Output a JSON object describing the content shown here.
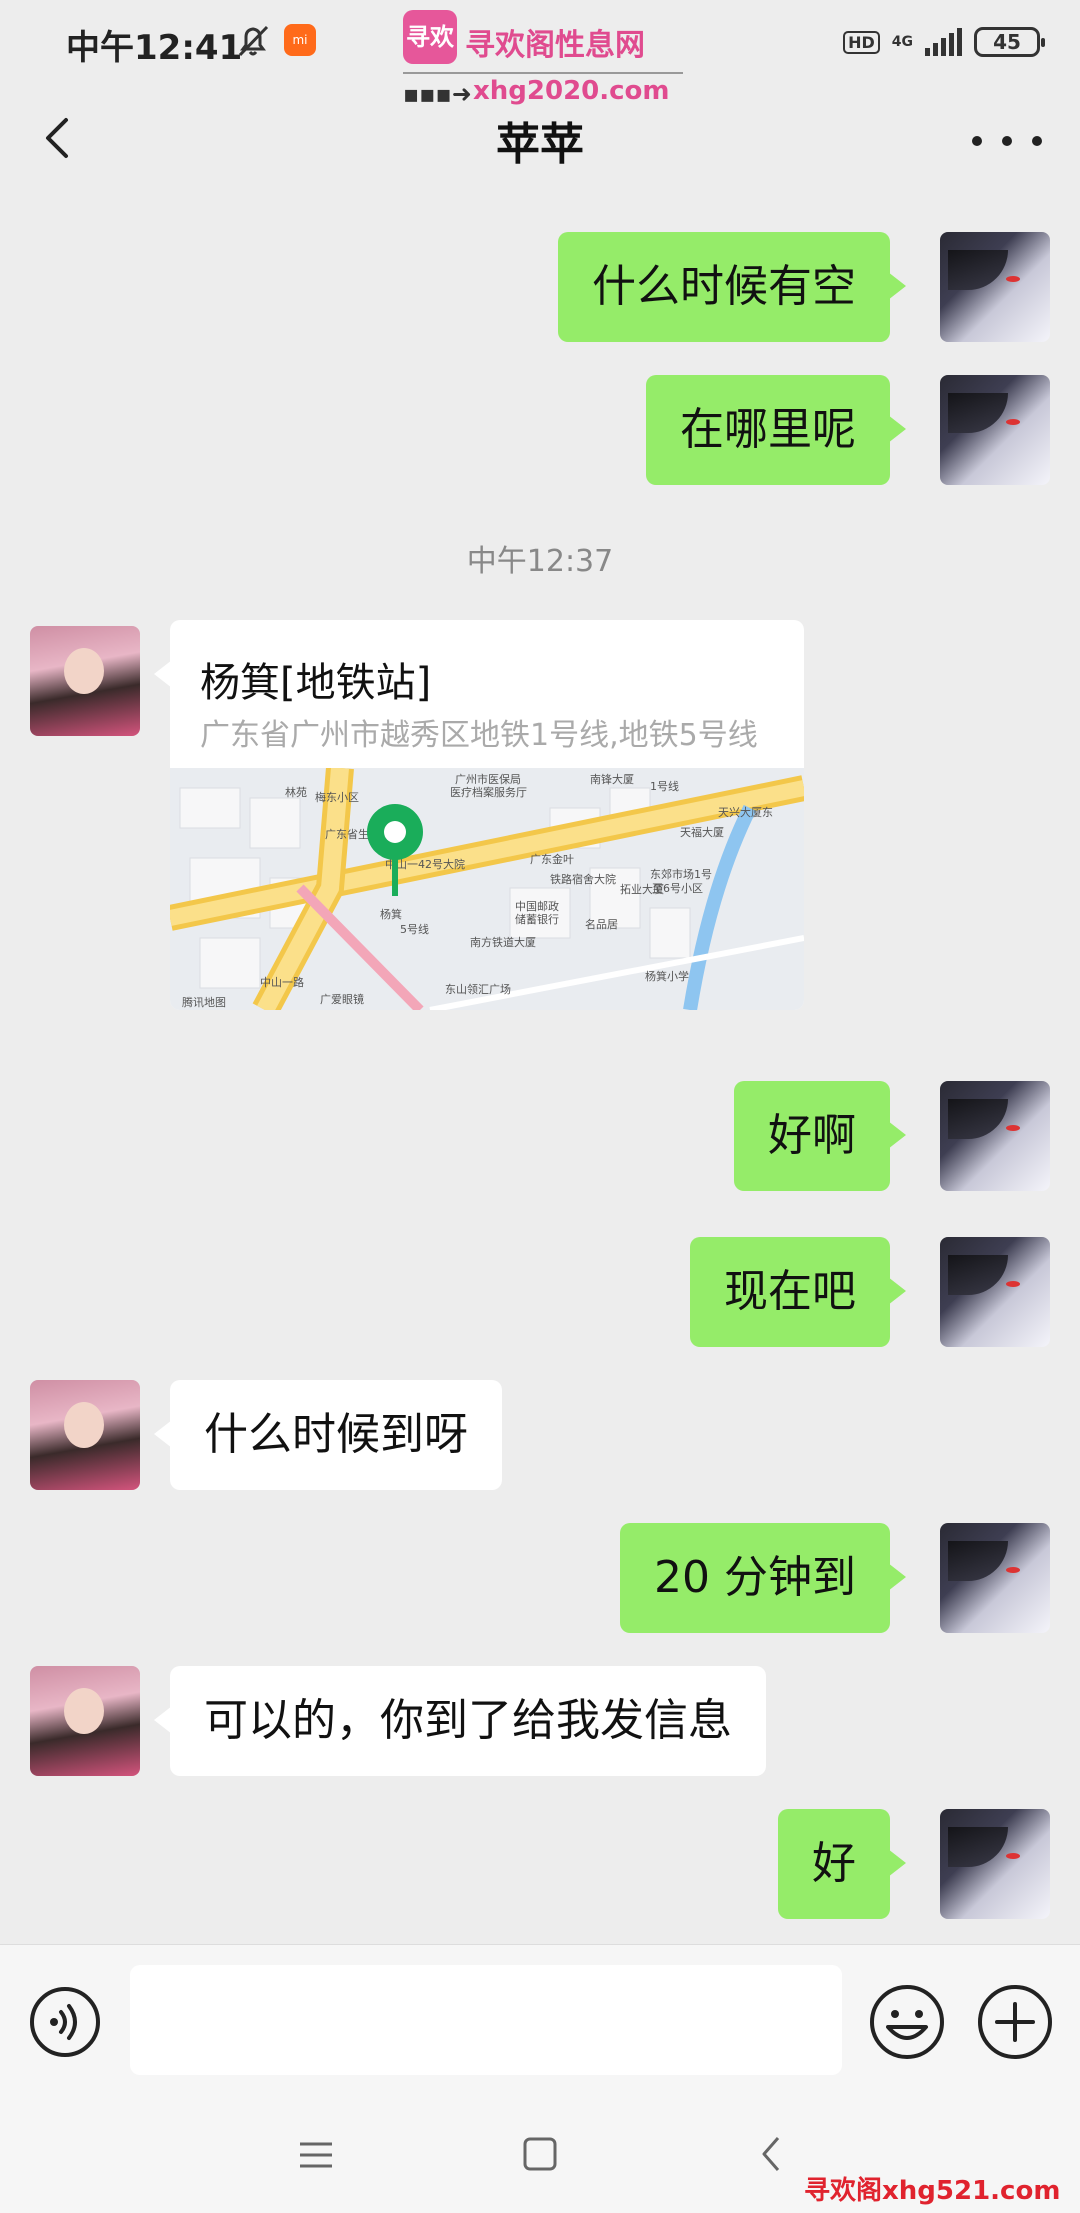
{
  "status_bar": {
    "time": "中午12:41",
    "hd": "HD",
    "network": "4G",
    "battery": "45"
  },
  "watermark": {
    "logo": "寻欢",
    "name": "寻欢阁性息网",
    "url": "xhg2020.com",
    "bottom": "寻欢阁xhg521.com"
  },
  "header": {
    "title": "苹苹"
  },
  "chat": {
    "messages": [
      {
        "from": "me",
        "text": "什么时候有空"
      },
      {
        "from": "me",
        "text": "在哪里呢"
      },
      {
        "from": "them",
        "text": "好啊"
      }
    ],
    "timestamp": "中午12:37",
    "location": {
      "name": "杨箕[地铁站]",
      "address": "广东省广州市越秀区地铁1号线,地铁5号线",
      "map_labels": [
        "林苑",
        "梅东小区",
        "广州市医保局",
        "医疗档案服务厅",
        "南锋大厦",
        "天兴大厦东",
        "天福大厦",
        "广东省生殖医院",
        "中山一42号大院",
        "广东金叶",
        "铁路宿舍大院",
        "拓业大厦",
        "东郊市场1号",
        "至6号小区",
        "中国邮政",
        "储蓄银行",
        "名品居",
        "南方铁道大厦",
        "杨箕小学",
        "东山领汇广场",
        "广爱眼镜",
        "中山一路",
        "腾讯地图",
        "杨箕",
        "1号线",
        "5号线"
      ]
    },
    "replies": [
      {
        "from": "me",
        "text": "好啊"
      },
      {
        "from": "me",
        "text": "现在吧"
      },
      {
        "from": "them",
        "text": "什么时候到呀"
      },
      {
        "from": "me",
        "text": "20 分钟到"
      },
      {
        "from": "them",
        "text": "可以的，你到了给我发信息"
      },
      {
        "from": "me",
        "text": "好"
      }
    ]
  },
  "input": {
    "value": "",
    "placeholder": ""
  },
  "icons": {
    "back": "chevron-left-icon",
    "more": "more-horizontal-icon",
    "voice": "voice-icon",
    "emoji": "emoji-icon",
    "plus": "plus-icon"
  },
  "colors": {
    "my_bubble": "#95ec69",
    "their_bubble": "#ffffff",
    "background": "#ededed",
    "map_pin": "#1aad5a"
  }
}
